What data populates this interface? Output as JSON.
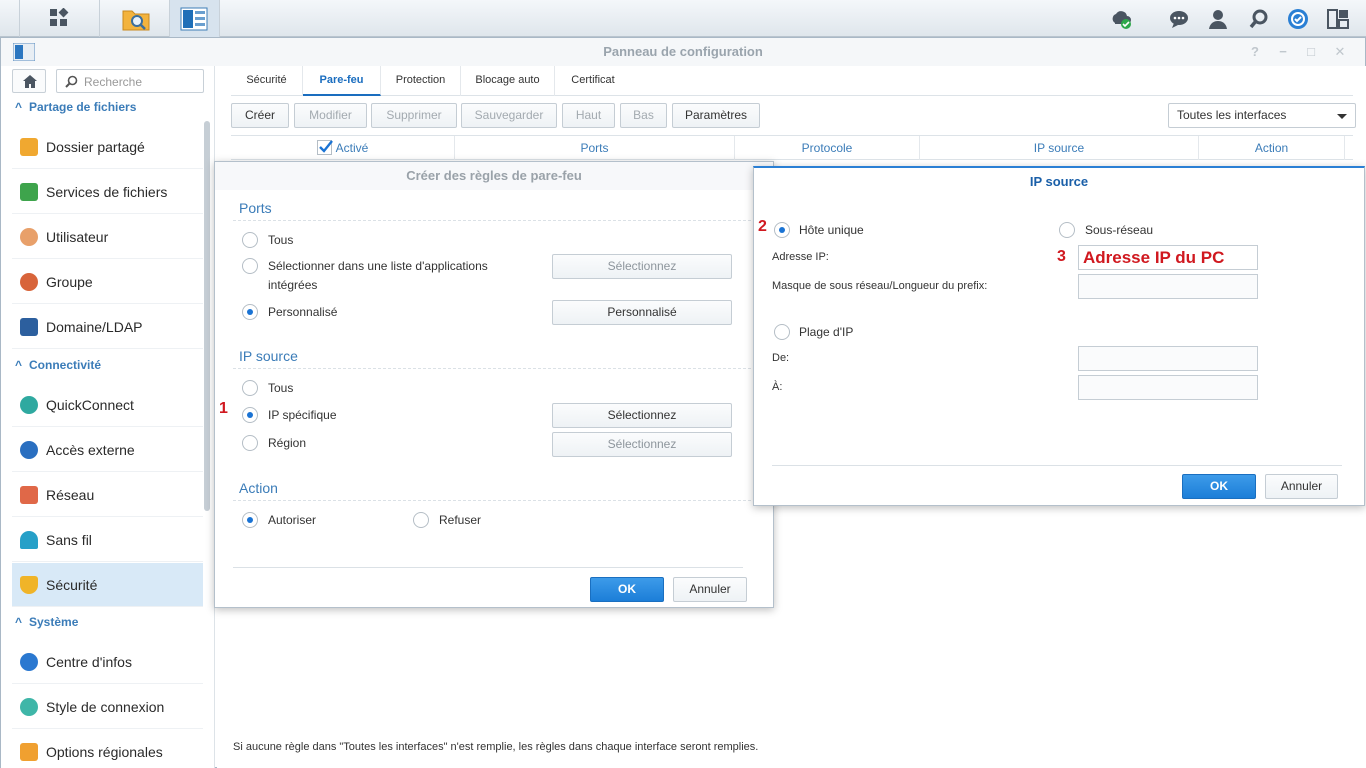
{
  "taskbar": {
    "buttons": [
      {
        "name": "main-menu",
        "icon": "grid-icon"
      },
      {
        "name": "file-station",
        "icon": "folder-search-icon"
      },
      {
        "name": "control-panel",
        "icon": "control-panel-icon"
      }
    ],
    "tray": [
      "cloud-sync-icon",
      "chat-icon",
      "user-icon",
      "search-icon",
      "dashboard-icon",
      "widgets-icon"
    ]
  },
  "window": {
    "title": "Panneau de configuration"
  },
  "sidebar": {
    "search_placeholder": "Recherche",
    "sections": [
      {
        "title": "Partage de fichiers",
        "items": [
          "Dossier partagé",
          "Services de fichiers",
          "Utilisateur",
          "Groupe",
          "Domaine/LDAP"
        ]
      },
      {
        "title": "Connectivité",
        "items": [
          "QuickConnect",
          "Accès externe",
          "Réseau",
          "Sans fil",
          "Sécurité"
        ]
      },
      {
        "title": "Système",
        "items": [
          "Centre d'infos",
          "Style de connexion",
          "Options régionales"
        ]
      }
    ],
    "active": "Sécurité"
  },
  "main": {
    "tabs": [
      "Sécurité",
      "Pare-feu",
      "Protection",
      "Blocage auto",
      "Certificat"
    ],
    "active_tab": "Pare-feu",
    "toolbar": {
      "create": "Créer",
      "modify": "Modifier",
      "delete": "Supprimer",
      "save": "Sauvegarder",
      "up": "Haut",
      "down": "Bas",
      "settings": "Paramètres"
    },
    "interface_select": "Toutes les interfaces",
    "columns": [
      "Activé",
      "Ports",
      "Protocole",
      "IP source",
      "Action"
    ],
    "footnote": "Si aucune règle dans \"Toutes les interfaces\" n'est remplie, les règles dans chaque interface seront remplies."
  },
  "rules_dialog": {
    "title": "Créer des règles de pare-feu",
    "ports": {
      "title": "Ports",
      "opt_all": "Tous",
      "opt_list_line1": "Sélectionner dans une liste d'applications",
      "opt_list_line2": "intégrées",
      "opt_custom": "Personnalisé",
      "btn_select": "Sélectionnez",
      "btn_custom": "Personnalisé"
    },
    "source_ip": {
      "title": "IP source",
      "opt_all": "Tous",
      "opt_specific": "IP spécifique",
      "opt_region": "Région",
      "btn_select": "Sélectionnez",
      "btn_select2": "Sélectionnez"
    },
    "action": {
      "title": "Action",
      "opt_allow": "Autoriser",
      "opt_deny": "Refuser"
    },
    "ok": "OK",
    "cancel": "Annuler",
    "step_marker": "1"
  },
  "ip_dialog": {
    "title": "IP source",
    "opt_single": "Hôte unique",
    "opt_subnet": "Sous-réseau",
    "label_ip": "Adresse IP:",
    "ip_value": "Adresse IP du PC",
    "label_mask": "Masque de sous réseau/Longueur du prefix:",
    "opt_range": "Plage d'IP",
    "label_from": "De:",
    "label_to": "À:",
    "ok": "OK",
    "cancel": "Annuler",
    "step_marker_2": "2",
    "step_marker_3": "3"
  },
  "colors": {
    "accent": "#1a73d4",
    "section_blue": "#3b7cb8",
    "annotation_red": "#d0181f"
  }
}
